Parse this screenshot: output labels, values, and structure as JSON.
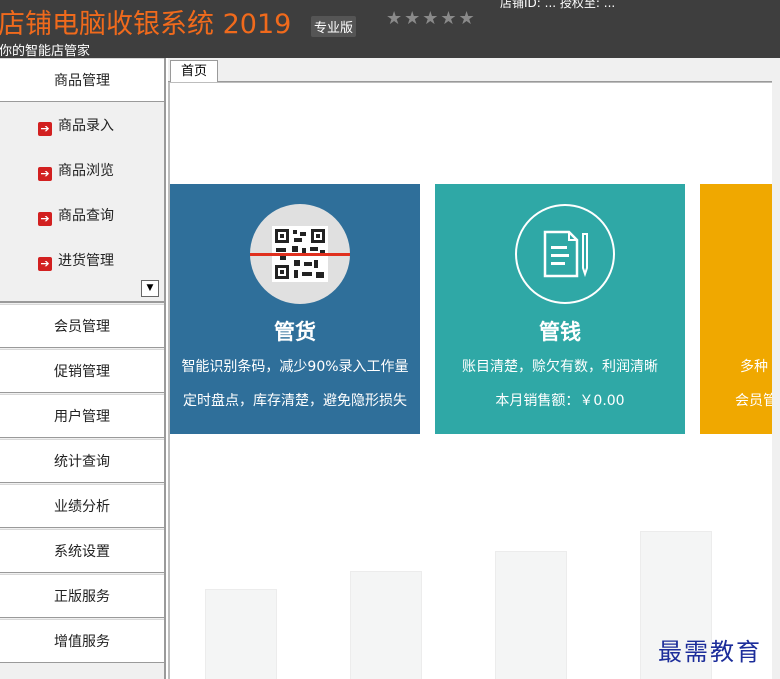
{
  "header": {
    "title": "店铺电脑收银系统 2019",
    "edition": "专业版",
    "tagline": "你的智能店管家",
    "rating_stars": "★★★★★",
    "top_info": "店铺ID: ... 授权至: ..."
  },
  "sidebar": {
    "items": [
      {
        "label": "商品管理"
      },
      {
        "label": "会员管理"
      },
      {
        "label": "促销管理"
      },
      {
        "label": "用户管理"
      },
      {
        "label": "统计查询"
      },
      {
        "label": "业绩分析"
      },
      {
        "label": "系统设置"
      },
      {
        "label": "正版服务"
      },
      {
        "label": "增值服务"
      }
    ],
    "submenu": [
      {
        "label": "商品录入"
      },
      {
        "label": "商品浏览"
      },
      {
        "label": "商品查询"
      },
      {
        "label": "进货管理"
      }
    ],
    "dropdown_glyph": "▼"
  },
  "tabs": [
    {
      "label": "首页"
    }
  ],
  "cards": {
    "goods": {
      "title": "管货",
      "line1": "智能识别条码，减少90%录入工作量",
      "line2": "定时盘点，库存清楚，避免隐形损失"
    },
    "money": {
      "title": "管钱",
      "line1": "账目清楚，赊欠有数，利润清晰",
      "line2": "本月销售额：￥0.00"
    },
    "member": {
      "line1": "多种",
      "line2": "会员管"
    }
  },
  "colors": {
    "header_bg": "#3e3e3e",
    "title_orange": "#f06a1c",
    "card_goods": "#2f6f9a",
    "card_money": "#2fa8a6",
    "card_member": "#f0a800"
  },
  "watermark": "最需教育"
}
